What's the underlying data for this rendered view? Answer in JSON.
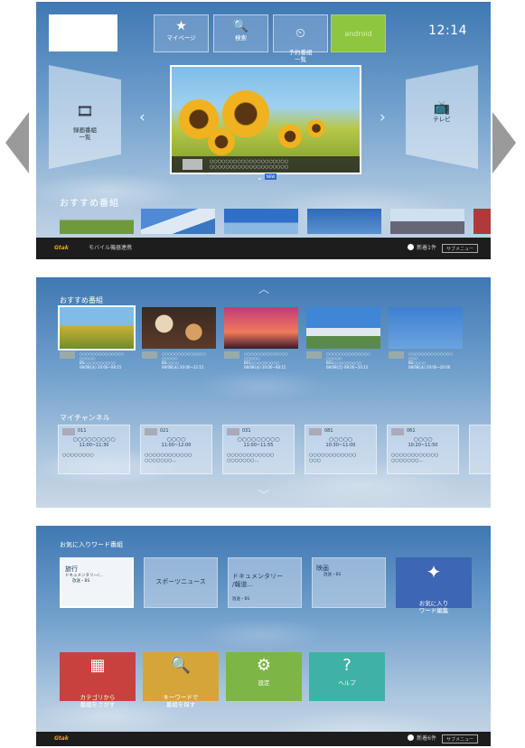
{
  "screen1": {
    "menu": [
      {
        "icon": "★",
        "label": "マイページ"
      },
      {
        "icon": "🔍",
        "label": "検索"
      },
      {
        "icon": "⏲",
        "label": "予約番組\n一覧"
      },
      {
        "icon": "",
        "label": "android"
      }
    ],
    "clock": "12:14",
    "left_panel": {
      "icon": "🎞",
      "label": "録画番組\n一覧"
    },
    "right_panel": {
      "icon": "📺",
      "label": "テレビ"
    },
    "feature_caption": "○○○○○○○○○○○○○○○○○○○○\n○○○○○○○○○○○○○○○○○○○○",
    "badge": "NEW",
    "section_title": "おすすめ番組",
    "bottom_bar": {
      "brand": "Gtak",
      "text": "モバイル機器連携",
      "notice": "新着1件",
      "submenu": "サブメニュー"
    }
  },
  "screen2": {
    "recommend_title": "おすすめ番組",
    "recommend": [
      {
        "title": "○○○○○○○○○○○○○○\n○○○○○",
        "channel": "BS○○○○○○○○○○",
        "time": "08/08(水) 20:00~08:15"
      },
      {
        "title": "○○○○○○○○○○○○○○\n○○○○○",
        "channel": "BS○○○○",
        "time": "08/08(水) 20:00~22:15"
      },
      {
        "title": "○○○○○○○○○○○○○○\n○○○○○",
        "channel": "BS1○○○○○○○○○",
        "time": "08/08(水) 20:00~08:15"
      },
      {
        "title": "○○○○○○○○○○○○○○\n○○○○○",
        "channel": "BS1○○○○○○○○○",
        "time": "08/08(月) 08:00~20:15"
      },
      {
        "title": "○○○○○○○○○○○○○○\n○○○",
        "channel": "BS○○○○",
        "time": "08/08(水) 20:00~20:00"
      }
    ],
    "channel_title": "マイチャンネル",
    "channels": [
      {
        "num": "011",
        "name": "○○○○○○○○○",
        "time": "11:00~11:30",
        "prog": "○○○○○○○○"
      },
      {
        "num": "021",
        "name": "○○○○",
        "time": "11:00~12:00",
        "prog": "○○○○○○○○○○○○\n○○○○○○○..."
      },
      {
        "num": "031",
        "name": "○○○○○○○○○",
        "time": "11:00~11:55",
        "prog": "○○○○○○○○○○○○\n○○○○○○○..."
      },
      {
        "num": "081",
        "name": "○○○○○",
        "time": "10:30~11:00",
        "prog": "○○○○○○○○○○○○\n○○○"
      },
      {
        "num": "061",
        "name": "○○○○",
        "time": "10:20~11:50",
        "prog": "○○○○○○○○○○○○\n○○○○○○○..."
      }
    ]
  },
  "screen3": {
    "title": "お気に入りワード番組",
    "tiles": [
      {
        "top": "旅行",
        "sub": "ドキュメンタリー/...",
        "sub2": "放送・BS"
      },
      {
        "top": "",
        "mid": "スポーツニュース"
      },
      {
        "top": "ドキュメンタリー\n/報道...",
        "sub": "放送・BS"
      },
      {
        "top": "映画",
        "sub": "放送・BS"
      }
    ],
    "fav": {
      "icon": "✦",
      "label": "お気に入り\nワード編集"
    },
    "buttons": [
      {
        "icon": "▦",
        "label": "カテゴリから\n番組をさがす",
        "color": "#c8413e"
      },
      {
        "icon": "🔍",
        "label": "キーワードで\n番組を探す",
        "color": "#d6a53a"
      },
      {
        "icon": "⚙",
        "label": "設定",
        "color": "#7db646"
      },
      {
        "icon": "?",
        "label": "ヘルプ",
        "color": "#3fb2a5"
      }
    ],
    "bottom_bar": {
      "brand": "Gtak",
      "notice": "新着6件",
      "submenu": "サブメニュー"
    }
  }
}
